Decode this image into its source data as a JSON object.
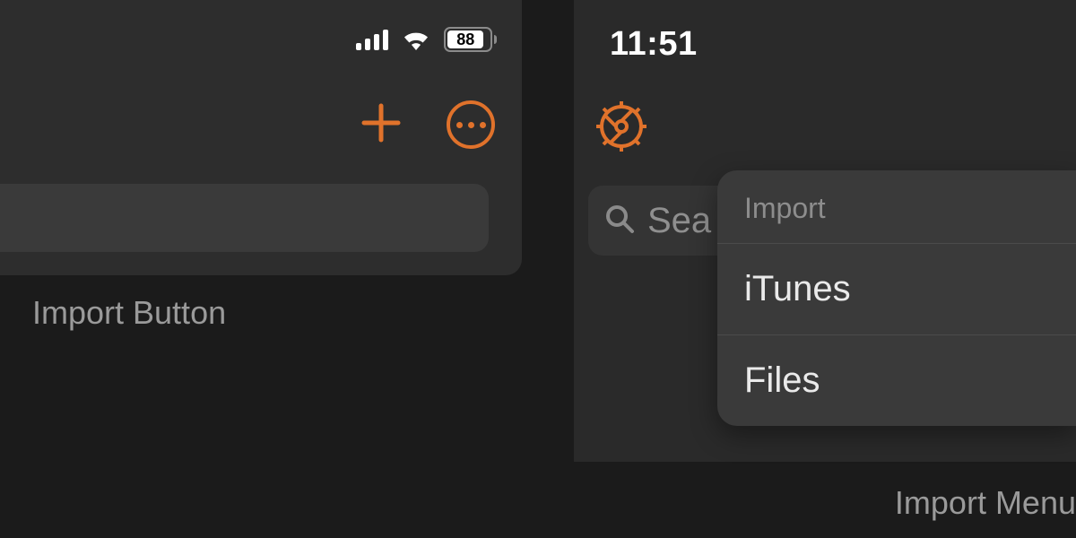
{
  "left": {
    "battery_percent": "88",
    "caption": "Import Button"
  },
  "right": {
    "time": "11:51",
    "search_placeholder": "Sea",
    "popup": {
      "header": "Import",
      "items": [
        "iTunes",
        "Files"
      ]
    },
    "caption": "Import Menu"
  },
  "colors": {
    "accent": "#e0722b"
  }
}
